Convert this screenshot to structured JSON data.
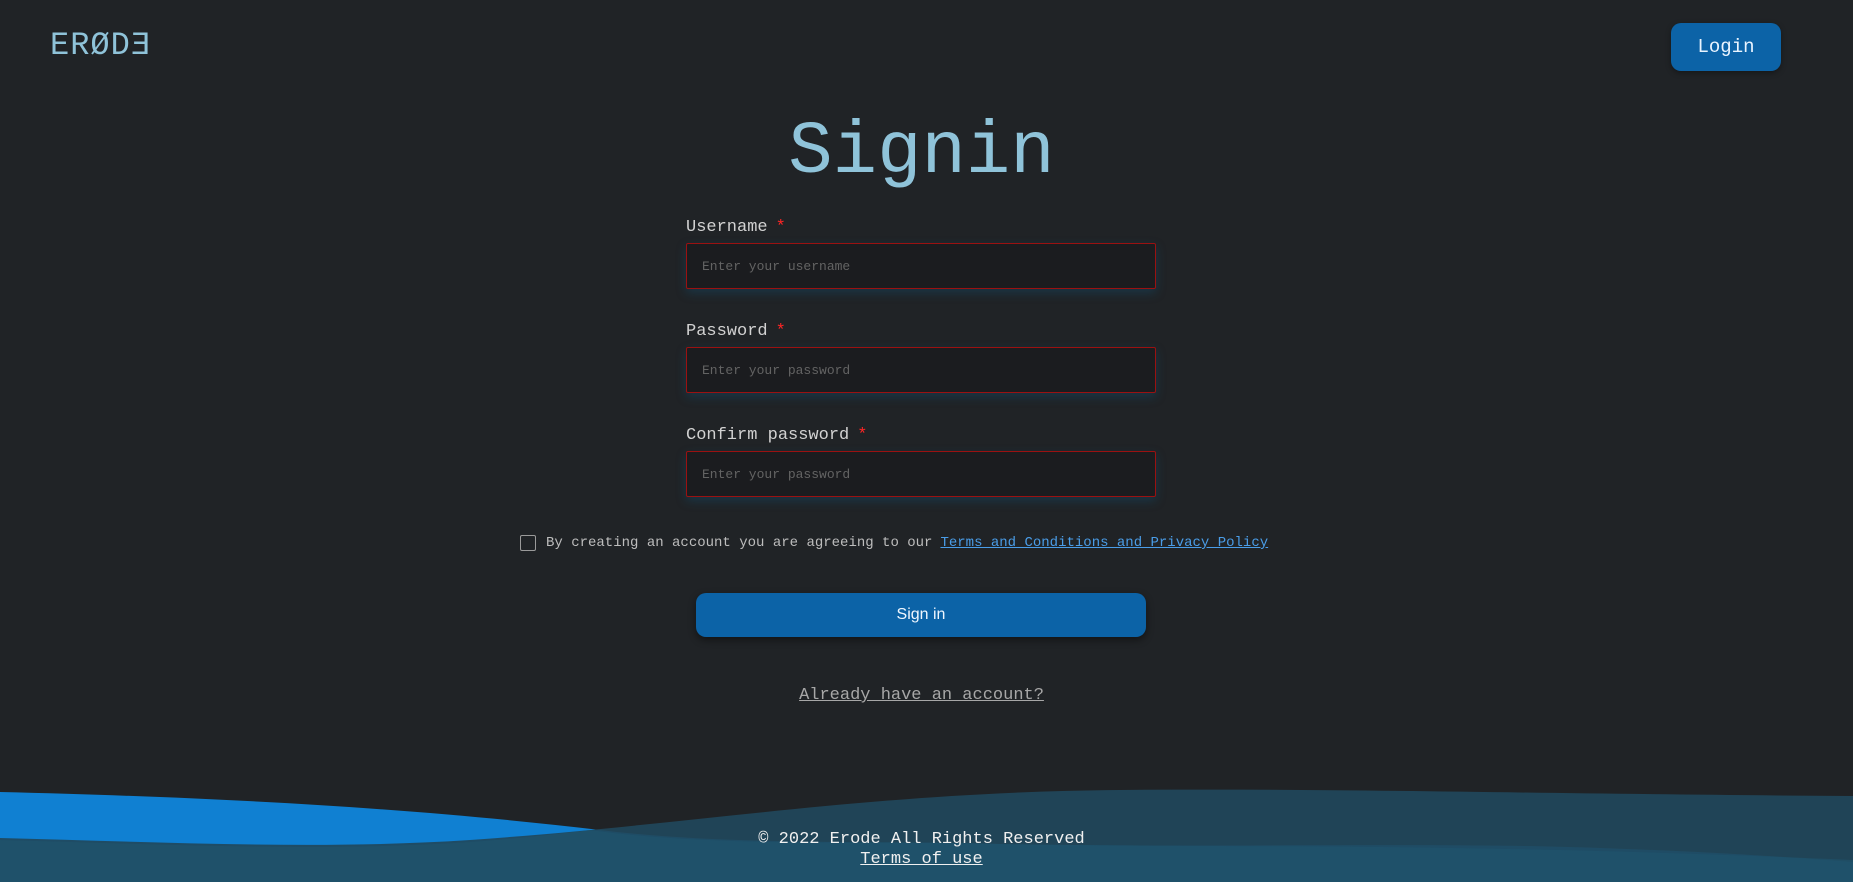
{
  "header": {
    "logo": "ERØDƎ",
    "login_label": "Login"
  },
  "form": {
    "title": "Signin",
    "fields": [
      {
        "label": "Username",
        "required_mark": "*",
        "placeholder": "Enter your username",
        "value": ""
      },
      {
        "label": "Password",
        "required_mark": "*",
        "placeholder": "Enter your password",
        "value": ""
      },
      {
        "label": "Confirm password",
        "required_mark": "*",
        "placeholder": "Enter your password",
        "value": ""
      }
    ],
    "agreement": {
      "text": "By creating an account you are agreeing to our",
      "link_text": "Terms and Conditions and Privacy Policy",
      "checked": false
    },
    "submit_label": "Sign in",
    "already_account": "Already have an account?"
  },
  "footer": {
    "copyright": "© 2022 Erode All Rights Reserved",
    "terms": "Terms of use"
  },
  "colors": {
    "background": "#202326",
    "accent": "#0c63a7",
    "title": "#8fc3d9",
    "error_border": "#9b1111",
    "link": "#4a9de8"
  }
}
